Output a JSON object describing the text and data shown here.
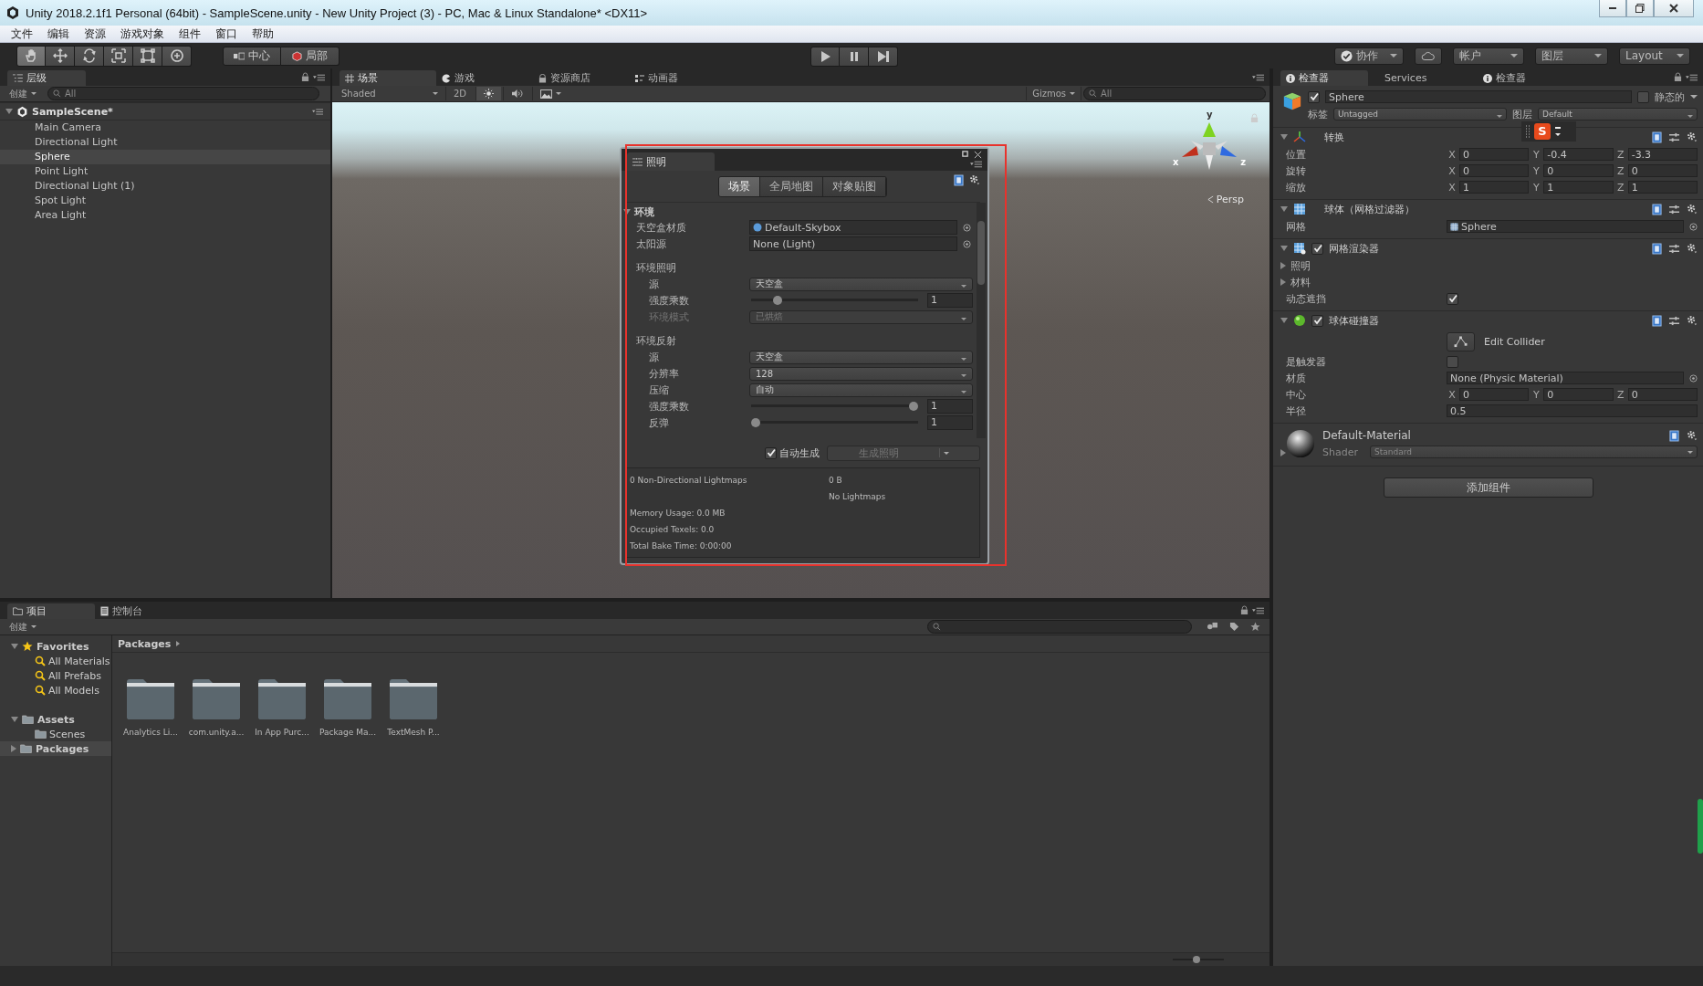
{
  "window": {
    "title": "Unity 2018.2.1f1 Personal (64bit) - SampleScene.unity - New Unity Project (3) - PC, Mac & Linux Standalone* <DX11>"
  },
  "menu": [
    "文件",
    "编辑",
    "资源",
    "游戏对象",
    "组件",
    "窗口",
    "帮助"
  ],
  "toolbar": {
    "tools": [
      {
        "kind": "hand",
        "selected": true
      },
      {
        "kind": "move",
        "selected": false
      },
      {
        "kind": "rotate",
        "selected": false
      },
      {
        "kind": "scale",
        "selected": false
      },
      {
        "kind": "rect",
        "selected": false
      },
      {
        "kind": "transform",
        "selected": false
      }
    ],
    "pivot": [
      {
        "kind": "pivot",
        "label": "中心"
      },
      {
        "kind": "space",
        "label": "局部"
      }
    ],
    "right": [
      {
        "kind": "collab",
        "label": "协作"
      },
      {
        "kind": "cloud"
      },
      {
        "kind": "dropdown",
        "label": "帐户"
      },
      {
        "kind": "dropdown",
        "label": "图层"
      },
      {
        "kind": "dropdown",
        "label": "Layout"
      }
    ]
  },
  "hierarchy": {
    "tab": "层级",
    "create": "创建",
    "search": {
      "placeholder": "All"
    },
    "scene": "SampleScene*",
    "items": [
      {
        "label": "Main Camera",
        "selected": false
      },
      {
        "label": "Directional Light",
        "selected": false
      },
      {
        "label": "Sphere",
        "selected": true
      },
      {
        "label": "Point Light",
        "selected": false
      },
      {
        "label": "Directional Light (1)",
        "selected": false
      },
      {
        "label": "Spot Light",
        "selected": false
      },
      {
        "label": "Area Light",
        "selected": false
      }
    ]
  },
  "scene_view": {
    "tabs": [
      {
        "kind": "scene",
        "label": "场景",
        "selected": true
      },
      {
        "kind": "game",
        "label": "游戏",
        "selected": false
      },
      {
        "kind": "store",
        "label": "资源商店",
        "selected": false
      },
      {
        "kind": "animator",
        "label": "动画器",
        "selected": false
      }
    ],
    "shading": "Shaded",
    "mode_2d": "2D",
    "lighting_on": true,
    "audio_on": false,
    "gizmos": "Gizmos",
    "search": {
      "placeholder": "All"
    },
    "axis_labels": {
      "y": "y",
      "x": "x",
      "z": "z"
    },
    "projection": "Persp"
  },
  "lighting": {
    "title": "照明",
    "tabs": [
      {
        "label": "场景",
        "selected": true
      },
      {
        "label": "全局地图",
        "selected": false
      },
      {
        "label": "对象贴图",
        "selected": false
      }
    ],
    "section": {
      "label": "环境",
      "expanded": true
    },
    "rows": [
      {
        "kind": "object",
        "label": "天空盒材质",
        "value": "Default-Skybox",
        "disabled": false
      },
      {
        "kind": "object",
        "label": "太阳源",
        "value": "None (Light)",
        "disabled": false
      },
      {
        "kind": "group",
        "label": "环境照明",
        "children": [
          {
            "kind": "dropdown",
            "label": "源",
            "value": "天空盒",
            "disabled": false
          },
          {
            "kind": "slider",
            "label": "强度乘数",
            "level": 0.14,
            "value": "1",
            "disabled": false
          },
          {
            "kind": "dropdown",
            "label": "环境模式",
            "value": "已烘焙",
            "disabled": true
          }
        ]
      },
      {
        "kind": "group",
        "label": "环境反射",
        "children": [
          {
            "kind": "dropdown",
            "label": "源",
            "value": "天空盒",
            "disabled": false
          },
          {
            "kind": "dropdown",
            "label": "分辨率",
            "value": "128",
            "disabled": false
          },
          {
            "kind": "dropdown",
            "label": "压缩",
            "value": "自动",
            "disabled": false
          },
          {
            "kind": "slider",
            "label": "强度乘数",
            "level": 1,
            "value": "1",
            "disabled": false
          },
          {
            "kind": "slider",
            "label": "反弹",
            "level": 0,
            "value": "1",
            "disabled": false
          }
        ]
      }
    ],
    "auto_generate": {
      "label": "自动生成",
      "checked": true
    },
    "generate": {
      "label": "生成照明",
      "disabled": true
    },
    "stats": {
      "lightmaps": "0 Non-Directional Lightmaps",
      "size": "0 B",
      "note": "No Lightmaps",
      "lines": [
        "Memory Usage: 0.0 MB",
        "Occupied Texels: 0.0",
        "Total Bake Time: 0:00:00"
      ]
    }
  },
  "project": {
    "tabs": [
      {
        "kind": "folder",
        "label": "项目",
        "selected": true
      },
      {
        "kind": "console",
        "label": "控制台",
        "selected": false
      }
    ],
    "create": "创建",
    "tree": [
      {
        "kind": "favorites",
        "label": "Favorites",
        "expanded": true,
        "selected": false,
        "children": [
          {
            "kind": "search",
            "label": "All Materials",
            "selected": false
          },
          {
            "kind": "search",
            "label": "All Prefabs",
            "selected": false
          },
          {
            "kind": "search",
            "label": "All Models",
            "selected": false
          }
        ]
      },
      {
        "kind": "folder",
        "label": "Assets",
        "expanded": true,
        "selected": false,
        "children": [
          {
            "kind": "folder",
            "label": "Scenes",
            "selected": false
          }
        ]
      },
      {
        "kind": "folder",
        "label": "Packages",
        "expanded": false,
        "selected": true
      }
    ],
    "breadcrumb": "Packages",
    "folders": [
      "Analytics Li...",
      "com.unity.a...",
      "In App Purc...",
      "Package Ma...",
      "TextMesh P..."
    ],
    "zoom_slider": {
      "level": 0.45
    }
  },
  "inspector": {
    "tabs": [
      {
        "kind": "info",
        "label": "检查器",
        "selected": true
      },
      {
        "kind": "plain",
        "label": "Services",
        "selected": false
      },
      {
        "kind": "info",
        "label": "检查器",
        "selected": false
      }
    ],
    "object": {
      "name": "Sphere",
      "active": true,
      "static_label": "静态的",
      "static": false,
      "tag_label": "标签",
      "tag": "Untagged",
      "layer_label": "图层",
      "layer": "Default"
    },
    "components": [
      {
        "kind": "transform",
        "title": "转换",
        "rows": [
          {
            "kind": "vector",
            "label": "位置",
            "fields": [
              {
                "axis": "X",
                "value": "0"
              },
              {
                "axis": "Y",
                "value": "-0.4"
              },
              {
                "axis": "Z",
                "value": "-3.3"
              }
            ]
          },
          {
            "kind": "vector",
            "label": "旋转",
            "fields": [
              {
                "axis": "X",
                "value": "0"
              },
              {
                "axis": "Y",
                "value": "0"
              },
              {
                "axis": "Z",
                "value": "0"
              }
            ]
          },
          {
            "kind": "vector",
            "label": "缩放",
            "fields": [
              {
                "axis": "X",
                "value": "1"
              },
              {
                "axis": "Y",
                "value": "1"
              },
              {
                "axis": "Z",
                "value": "1"
              }
            ]
          }
        ]
      },
      {
        "kind": "mesh_filter",
        "title": "球体（网格过滤器）",
        "rows": [
          {
            "kind": "object",
            "label": "网格",
            "value": "Sphere"
          }
        ]
      },
      {
        "kind": "mesh_renderer",
        "title": "网格渲染器",
        "enabled": true,
        "rows": [
          {
            "kind": "foldout",
            "label": "照明"
          },
          {
            "kind": "foldout",
            "label": "材料"
          },
          {
            "kind": "check",
            "label": "动态遮挡",
            "checked": true
          }
        ]
      },
      {
        "kind": "sphere_collider",
        "title": "球体碰撞器",
        "enabled": true,
        "rows": [
          {
            "kind": "edit",
            "value": "Edit Collider"
          },
          {
            "kind": "check",
            "label": "是触发器",
            "checked": false
          },
          {
            "kind": "object",
            "label": "材质",
            "value": "None (Physic Material)"
          },
          {
            "kind": "vector",
            "label": "中心",
            "fields": [
              {
                "axis": "X",
                "value": "0"
              },
              {
                "axis": "Y",
                "value": "0"
              },
              {
                "axis": "Z",
                "value": "0"
              }
            ]
          },
          {
            "kind": "text",
            "label": "半径",
            "value": "0.5"
          }
        ]
      }
    ],
    "material": {
      "name": "Default-Material",
      "shader_label": "Shader",
      "shader": "Standard"
    },
    "add_component": "添加组件"
  },
  "ime_toolbar": {
    "logo": "S"
  }
}
